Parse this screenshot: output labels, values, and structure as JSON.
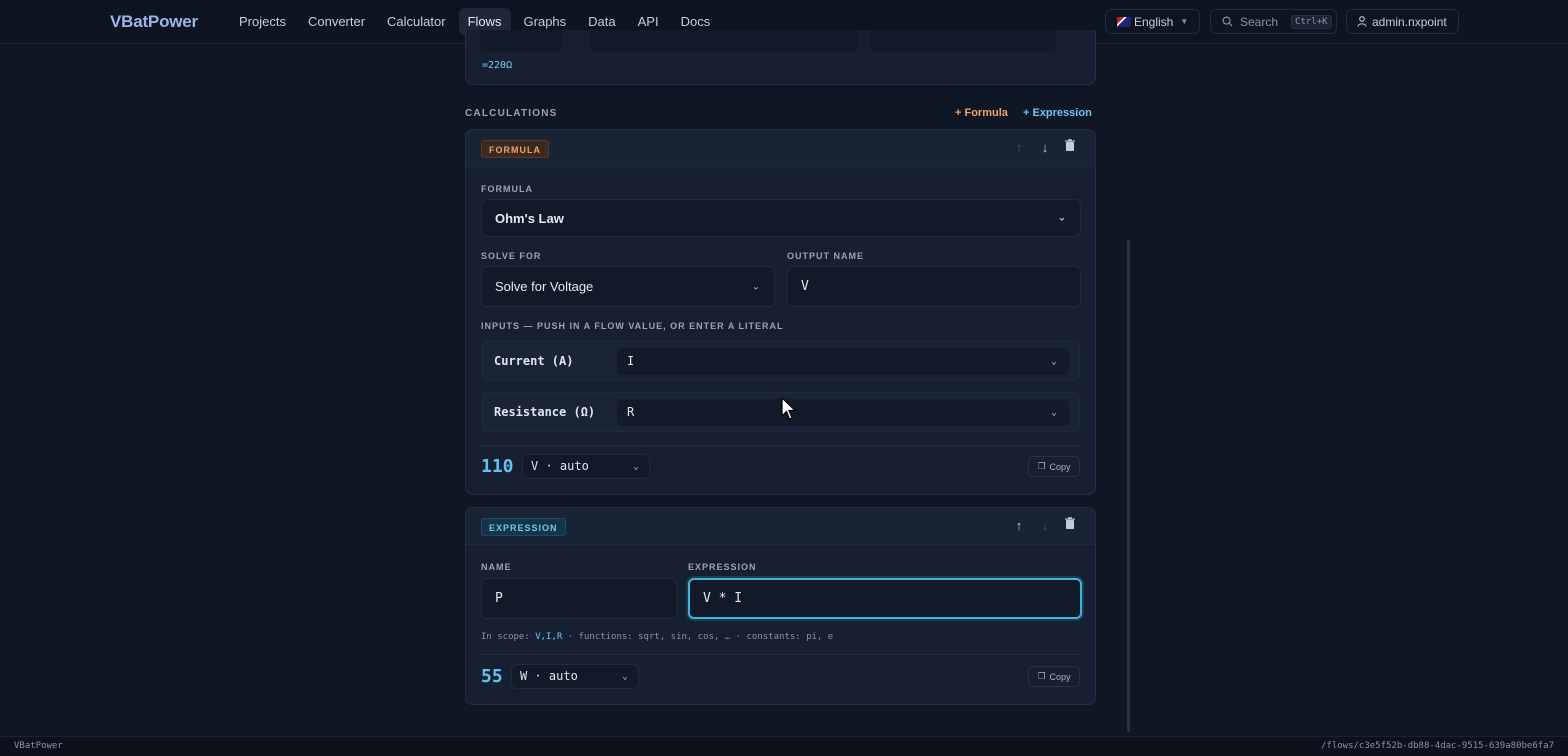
{
  "nav": {
    "brand": "VBatPower",
    "links": [
      "Projects",
      "Converter",
      "Calculator",
      "Flows",
      "Graphs",
      "Data",
      "API",
      "Docs"
    ],
    "active": "Flows",
    "language": "English",
    "search_label": "Search",
    "search_shortcut": "Ctrl+K",
    "user": "admin.nxpoint"
  },
  "top_card": {
    "equation_value": "=220Ω"
  },
  "calculations": {
    "section_label": "CALCULATIONS",
    "add_formula": "+ Formula",
    "add_expression": "+ Expression"
  },
  "formula_card": {
    "badge": "FORMULA",
    "formula_label": "FORMULA",
    "formula_value": "Ohm's Law",
    "solve_for_label": "SOLVE FOR",
    "solve_for_value": "Solve for Voltage",
    "output_name_label": "OUTPUT NAME",
    "output_name_value": "V",
    "inputs_label": "INPUTS — PUSH IN A FLOW VALUE, OR ENTER A LITERAL",
    "inputs": [
      {
        "label": "Current (A)",
        "value": "I"
      },
      {
        "label": "Resistance (Ω)",
        "value": "R"
      }
    ],
    "result_value": "110",
    "result_unit": "V · auto",
    "copy_label": "Copy"
  },
  "expression_card": {
    "badge": "EXPRESSION",
    "name_label": "NAME",
    "name_value": "P",
    "expression_label": "EXPRESSION",
    "expression_value": "V * I",
    "hint_prefix": "In scope: ",
    "hint_scope": "V,I,R",
    "hint_suffix": " · functions: sqrt, sin, cos, … · constants: pi, e",
    "result_value": "55",
    "result_unit": "W · auto",
    "copy_label": "Copy"
  },
  "footer": {
    "left": "VBatPower",
    "right": "/flows/c3e5f52b-db88-4dac-9515-639a80be6fa7"
  },
  "colors": {
    "accent_formula": "#f0a36a",
    "accent_expression": "#6cc4f0",
    "result": "#5fc4ee",
    "background": "#0f1624"
  }
}
